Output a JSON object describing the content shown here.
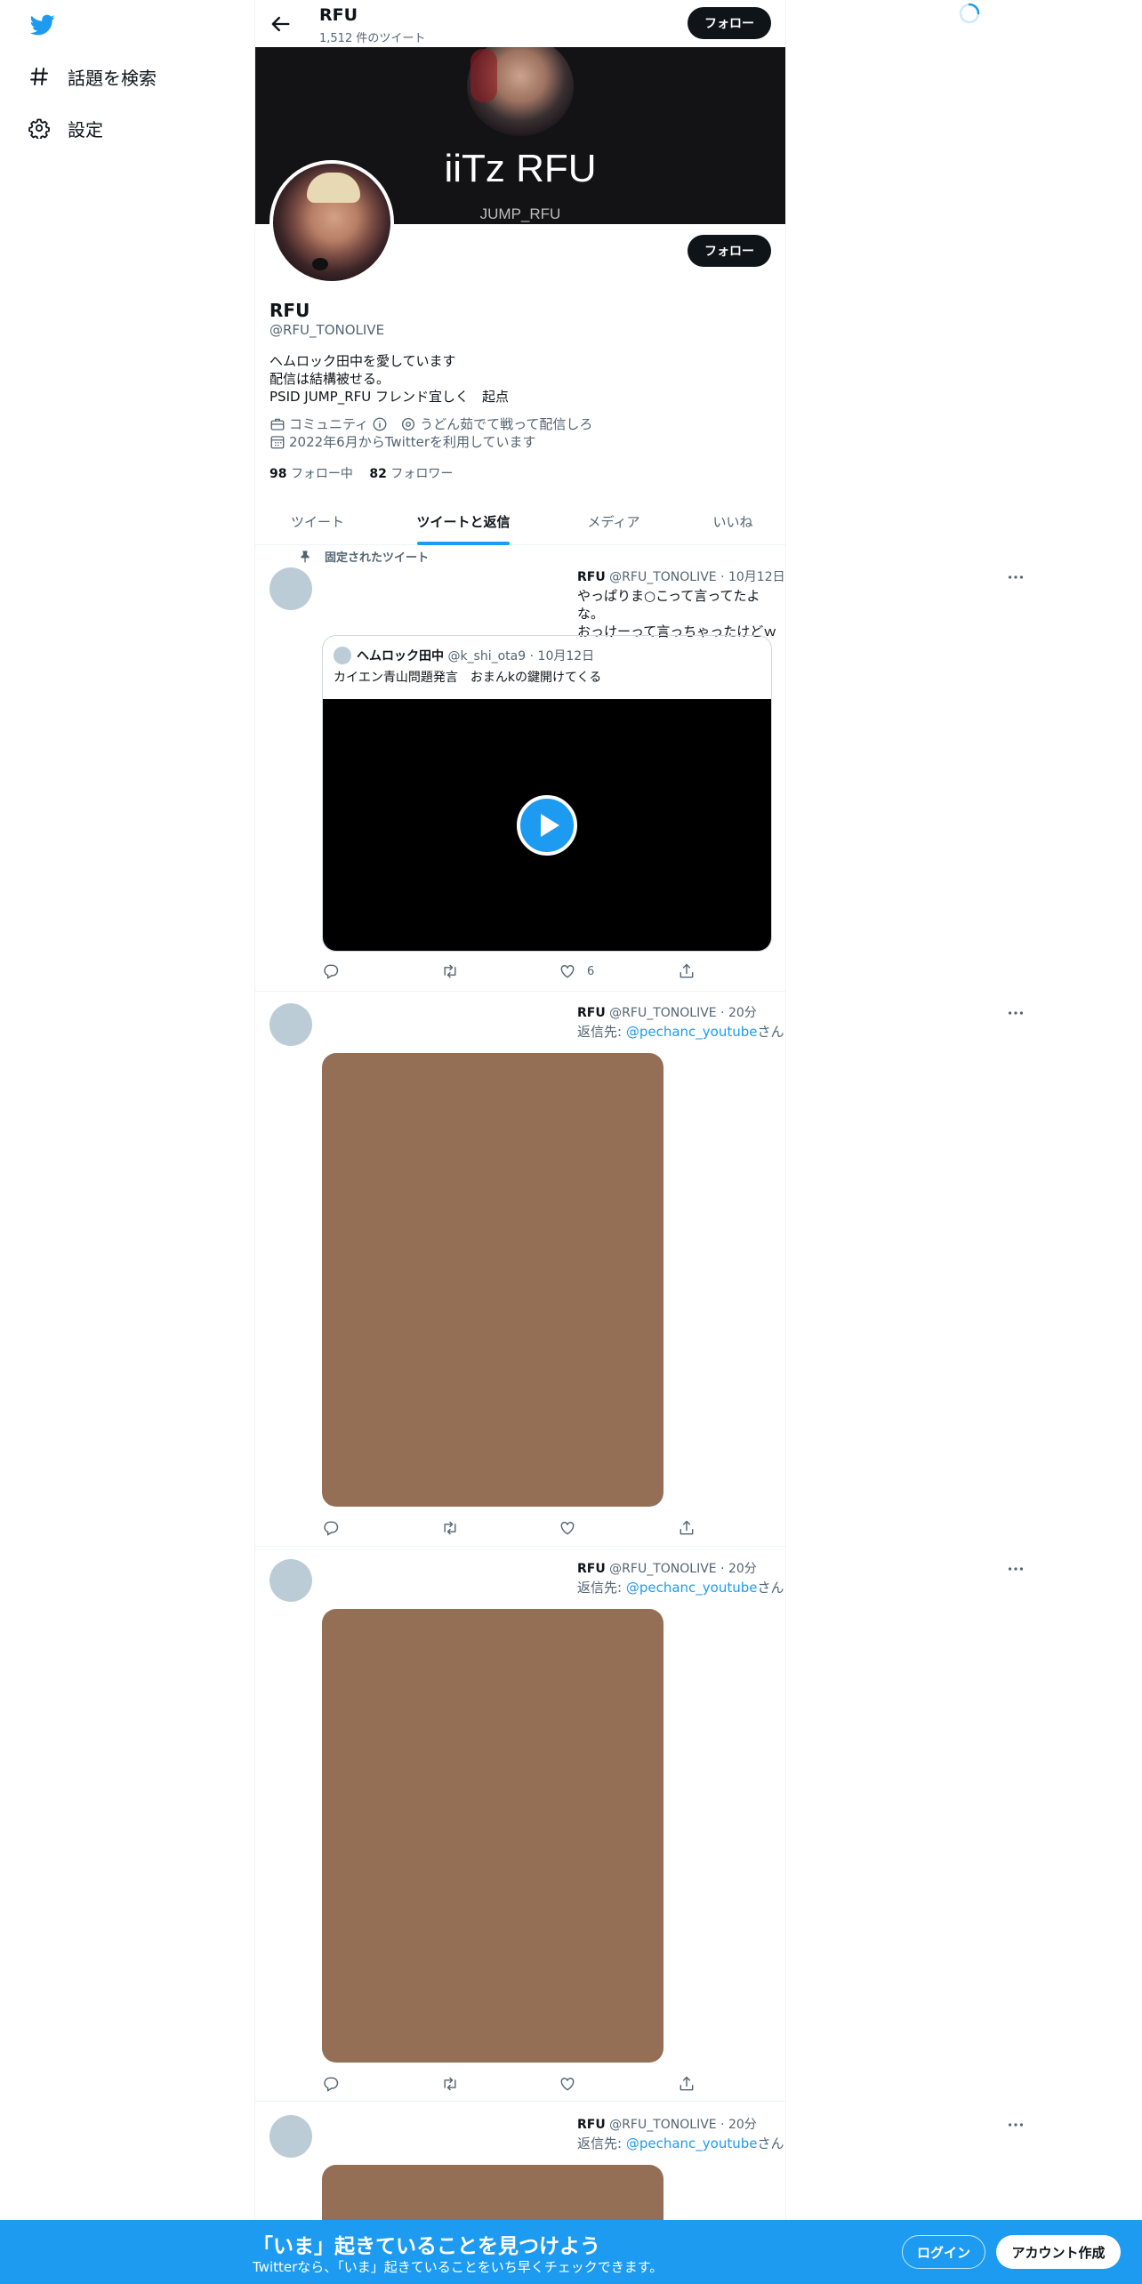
{
  "nav": {
    "logo_icon": "twitter-bird-icon",
    "items": [
      {
        "label": "話題を検索",
        "icon": "hashtag-icon"
      },
      {
        "label": "設定",
        "icon": "gear-icon"
      }
    ]
  },
  "header": {
    "title": "RFU",
    "subtitle": "1,512 件のツイート",
    "follow_label": "フォロー"
  },
  "banner": {
    "name": "iiTz RFU",
    "sub": "JUMP_RFU"
  },
  "profile": {
    "display_name": "RFU",
    "handle": "@RFU_TONOLIVE",
    "follow_label": "フォロー",
    "bio": [
      "ヘムロック田中を愛しています",
      "配信は結構被せる。",
      "PSID JUMP_RFU フレンド宜しく　起点"
    ],
    "category": "コミュニティ",
    "location": "うどん茹でて戦って配信しろ",
    "joined": "2022年6月からTwitterを利用しています",
    "following_count": "98",
    "following_label": "フォロー中",
    "followers_count": "82",
    "followers_label": "フォロワー"
  },
  "tabs": [
    {
      "label": "ツイート",
      "active": false
    },
    {
      "label": "ツイートと返信",
      "active": true
    },
    {
      "label": "メディア",
      "active": false
    },
    {
      "label": "いいね",
      "active": false
    }
  ],
  "tweets": [
    {
      "pinned_label": "固定されたツイート",
      "name": "RFU",
      "handle": "@RFU_TONOLIVE",
      "time": "10月12日",
      "text": [
        "やっぱりま○こって言ってたよな。",
        "おっけーって言っちゃったけどｗ"
      ],
      "quote": {
        "name": "ヘムロック田中",
        "handle": "@k_shi_ota9",
        "time": "10月12日",
        "text": "カイエン青山問題発言　おまんkの鍵開けてくる"
      },
      "like_count": "6"
    },
    {
      "name": "RFU",
      "handle": "@RFU_TONOLIVE",
      "time": "20分",
      "reply_prefix": "返信先: ",
      "reply_to": "@pechanc_youtube",
      "reply_suffix": "さん"
    },
    {
      "name": "RFU",
      "handle": "@RFU_TONOLIVE",
      "time": "20分",
      "reply_prefix": "返信先: ",
      "reply_to": "@pechanc_youtube",
      "reply_suffix": "さん"
    },
    {
      "name": "RFU",
      "handle": "@RFU_TONOLIVE",
      "time": "20分",
      "reply_prefix": "返信先: ",
      "reply_to": "@pechanc_youtube",
      "reply_suffix": "さん"
    }
  ],
  "separator": " · ",
  "bottom_bar": {
    "title": "「いま」起きていることを見つけよう",
    "subtitle": "Twitterなら、「いま」起きていることをいち早くチェックできます。",
    "login_label": "ログイン",
    "signup_label": "アカウント作成"
  },
  "colors": {
    "accent": "#1d9bf0",
    "text": "#0f1419",
    "muted": "#536471",
    "media_placeholder": "#946f56",
    "banner_bg": "#131315"
  }
}
